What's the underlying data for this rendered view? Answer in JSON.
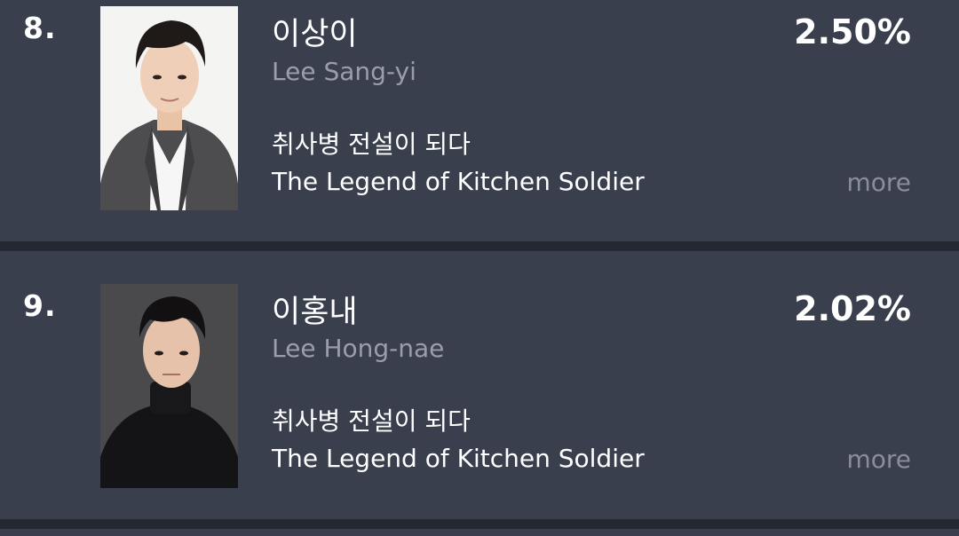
{
  "rankings": [
    {
      "rank": "8.",
      "name_ko": "이상이",
      "name_en": "Lee Sang-yi",
      "show_ko": "취사병 전설이 되다",
      "show_en": "The Legend of Kitchen Soldier",
      "percentage": "2.50%",
      "more_label": "more"
    },
    {
      "rank": "9.",
      "name_ko": "이홍내",
      "name_en": "Lee Hong-nae",
      "show_ko": "취사병 전설이 되다",
      "show_en": "The Legend of Kitchen Soldier",
      "percentage": "2.02%",
      "more_label": "more"
    }
  ],
  "colors": {
    "background": "#242833",
    "card": "#3a3f4e",
    "text_primary": "#ffffff",
    "text_secondary": "#9a9eaa",
    "more_link": "#8a8e9a"
  }
}
